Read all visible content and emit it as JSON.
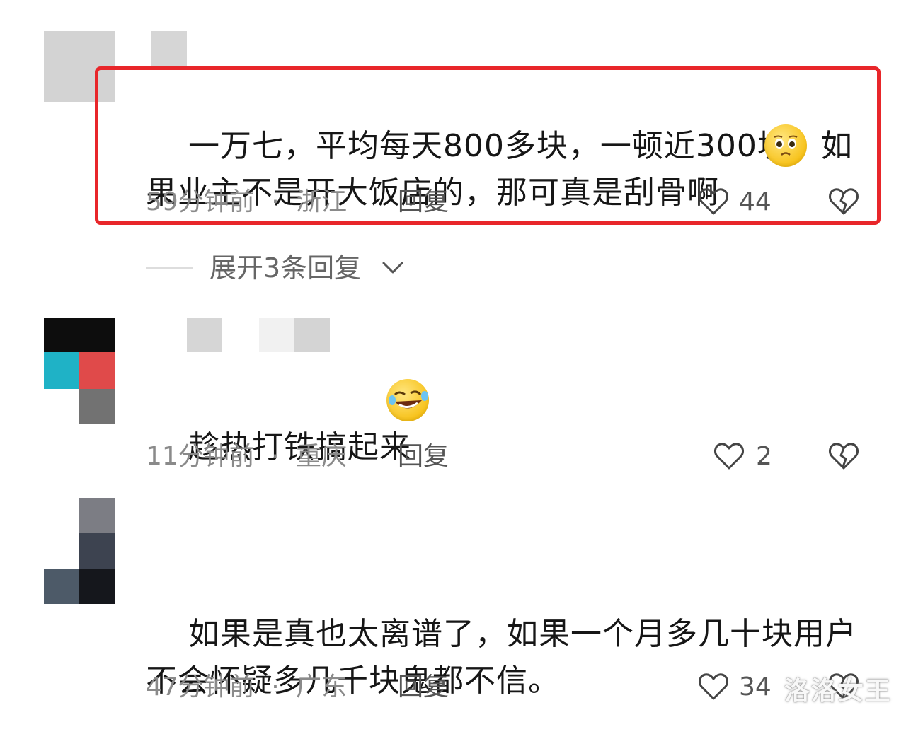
{
  "comments": [
    {
      "text": "一万七，平均每天800多块，一顿近300块，如果业主不是开大饭店的，那可真是刮骨啊",
      "emoji": "pleading-face-emoji",
      "time": "59分钟前",
      "location": "浙江",
      "reply_label": "回复",
      "likes": "44"
    },
    {
      "text": "趁热打铁搞起来",
      "emoji": "rolling-laughing-emoji",
      "time": "11分钟前",
      "location": "重庆",
      "reply_label": "回复",
      "likes": "2"
    },
    {
      "text": "如果是真也太离谱了，如果一个月多几十块用户不会怀疑多几千块鬼都不信。",
      "time": "47分钟前",
      "location": "广东",
      "reply_label": "回复",
      "likes": "34"
    }
  ],
  "expand_replies": "展开3条回复",
  "meta_separator": "·",
  "watermark": "洛洛女王",
  "colors": {
    "highlight_border": "#e8262a",
    "meta_text": "#8a8a8a"
  }
}
